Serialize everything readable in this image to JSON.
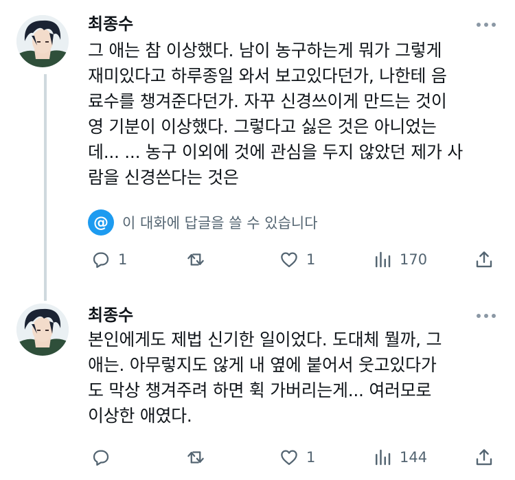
{
  "tweets": [
    {
      "author": "최종수",
      "text": "그 애는 참 이상했다. 남이 농구하는게 뭐가 그렇게\n재미있다고 하루종일 와서 보고있다던가, 나한테 음\n료수를 챙겨준다던가. 자꾸 신경쓰이게 만드는 것이\n영 기분이 이상했다. 그렇다고 싫은 것은 아니었는\n데... ... 농구 이외에 것에 관심을 두지 않았던 제가 사\n람을 신경쓴다는 것은",
      "reply_restriction": "이 대화에 답글을 쓸 수 있습니다",
      "reply_count": "1",
      "retweet_count": "",
      "like_count": "1",
      "view_count": "170"
    },
    {
      "author": "최종수",
      "text": "본인에게도 제법 신기한 일이었다. 도대체 뭘까, 그\n애는. 아무렇지도 않게 내 옆에 붙어서 웃고있다가\n도 막상 챙겨주려 하면 휙 가버리는게... 여러모로\n이상한 애였다.",
      "reply_count": "",
      "retweet_count": "",
      "like_count": "1",
      "view_count": "144"
    }
  ],
  "icons": {
    "reply": "reply-icon",
    "retweet": "retweet-icon",
    "like": "heart-icon",
    "views": "views-icon",
    "share": "share-icon",
    "more": "more-icon",
    "mention": "mention-icon"
  },
  "colors": {
    "accent": "#1d9bf0",
    "muted": "#536471",
    "thread_line": "#cfd9de"
  }
}
